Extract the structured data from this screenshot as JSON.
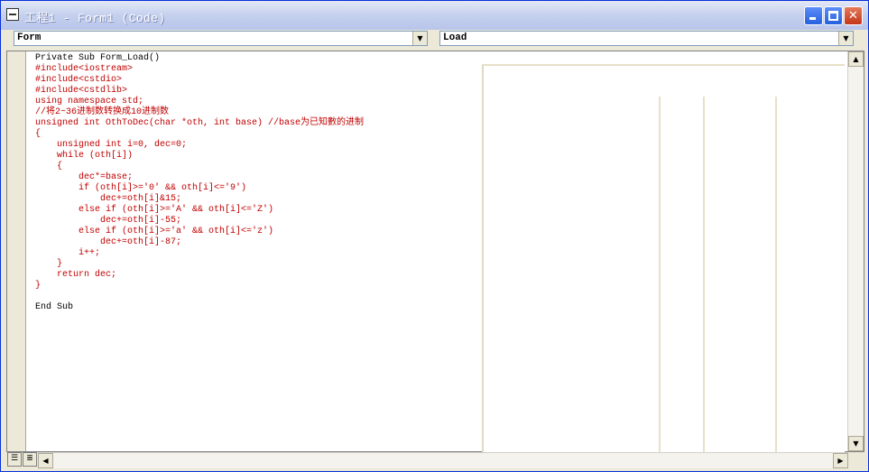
{
  "window": {
    "title": "工程1 - Form1 (Code)"
  },
  "object_combo": {
    "value": "Form"
  },
  "procedure_combo": {
    "value": "Load"
  },
  "code_lines": [
    {
      "text": "Private Sub Form_Load()",
      "error": false
    },
    {
      "text": "#include<iostream>",
      "error": true
    },
    {
      "text": "#include<cstdio>",
      "error": true
    },
    {
      "text": "#include<cstdlib>",
      "error": true
    },
    {
      "text": "using namespace std;",
      "error": true
    },
    {
      "text": "//将2~36进制数转换成10进制数",
      "error": true
    },
    {
      "text": "unsigned int OthToDec(char *oth, int base) //base为已知數的进制",
      "error": true
    },
    {
      "text": "{",
      "error": true
    },
    {
      "text": "    unsigned int i=0, dec=0;",
      "error": true
    },
    {
      "text": "    while (oth[i])",
      "error": true
    },
    {
      "text": "    {",
      "error": true
    },
    {
      "text": "        dec*=base;",
      "error": true
    },
    {
      "text": "        if (oth[i]>='0' && oth[i]<='9')",
      "error": true
    },
    {
      "text": "            dec+=oth[i]&15;",
      "error": true
    },
    {
      "text": "        else if (oth[i]>='A' && oth[i]<='Z')",
      "error": true
    },
    {
      "text": "            dec+=oth[i]-55;",
      "error": true
    },
    {
      "text": "        else if (oth[i]>='a' && oth[i]<='z')",
      "error": true
    },
    {
      "text": "            dec+=oth[i]-87;",
      "error": true
    },
    {
      "text": "        i++;",
      "error": true
    },
    {
      "text": "    }",
      "error": true
    },
    {
      "text": "    return dec;",
      "error": true
    },
    {
      "text": "}",
      "error": true
    },
    {
      "text": "",
      "error": false
    },
    {
      "text": "End Sub",
      "error": false
    }
  ],
  "icons": {
    "minimize": "minimize-icon",
    "maximize": "maximize-icon",
    "close": "close-icon",
    "dropdown": "chevron-down-icon"
  },
  "colors": {
    "error_text": "#c00000",
    "title_bar": "#c5d0ee",
    "close_button": "#c4361a"
  }
}
